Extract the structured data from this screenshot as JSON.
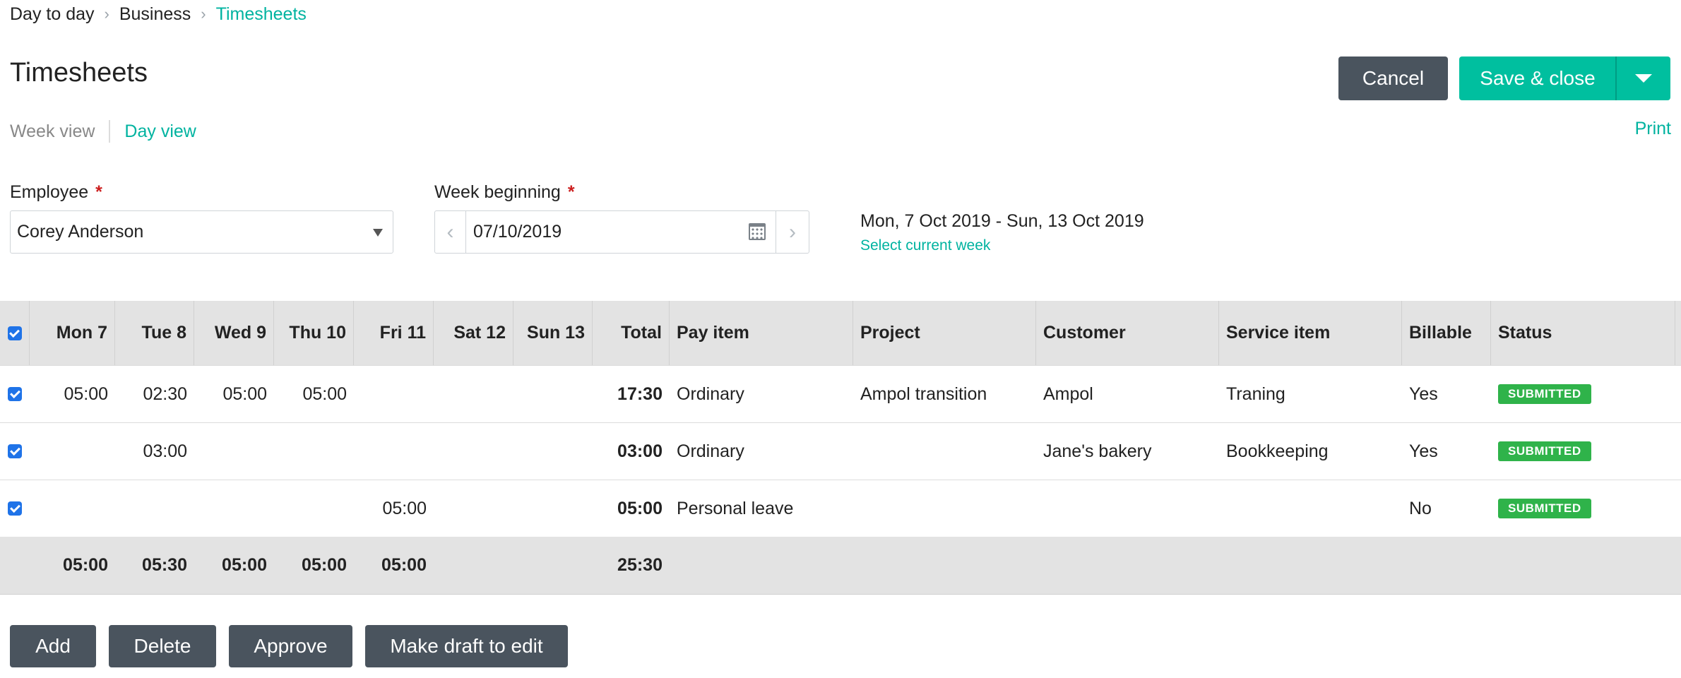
{
  "breadcrumb": [
    "Day to day",
    "Business",
    "Timesheets"
  ],
  "page_title": "Timesheets",
  "header_buttons": {
    "cancel": "Cancel",
    "save_close": "Save & close"
  },
  "view_tabs": {
    "week": "Week view",
    "day": "Day view",
    "print": "Print"
  },
  "form": {
    "employee_label": "Employee",
    "employee_value": "Corey  Anderson",
    "week_label": "Week beginning",
    "week_value": "07/10/2019",
    "required_mark": "*",
    "week_range": "Mon, 7 Oct 2019 - Sun, 13 Oct 2019",
    "select_current_week": "Select current week"
  },
  "table": {
    "columns": [
      "Mon 7",
      "Tue 8",
      "Wed 9",
      "Thu 10",
      "Fri 11",
      "Sat 12",
      "Sun 13",
      "Total",
      "Pay item",
      "Project",
      "Customer",
      "Service item",
      "Billable",
      "Status"
    ],
    "rows": [
      {
        "mon": "05:00",
        "tue": "02:30",
        "wed": "05:00",
        "thu": "05:00",
        "fri": "",
        "sat": "",
        "sun": "",
        "total": "17:30",
        "pay_item": "Ordinary",
        "project": "Ampol transition",
        "customer": "Ampol",
        "service_item": "Traning",
        "billable": "Yes",
        "status": "SUBMITTED"
      },
      {
        "mon": "",
        "tue": "03:00",
        "wed": "",
        "thu": "",
        "fri": "",
        "sat": "",
        "sun": "",
        "total": "03:00",
        "pay_item": "Ordinary",
        "project": "",
        "customer": "Jane's bakery",
        "service_item": "Bookkeeping",
        "billable": "Yes",
        "status": "SUBMITTED"
      },
      {
        "mon": "",
        "tue": "",
        "wed": "",
        "thu": "",
        "fri": "05:00",
        "sat": "",
        "sun": "",
        "total": "05:00",
        "pay_item": "Personal leave",
        "project": "",
        "customer": "",
        "service_item": "",
        "billable": "No",
        "status": "SUBMITTED"
      }
    ],
    "totals": {
      "mon": "05:00",
      "tue": "05:30",
      "wed": "05:00",
      "thu": "05:00",
      "fri": "05:00",
      "total": "25:30"
    }
  },
  "actions": {
    "add": "Add",
    "delete": "Delete",
    "approve": "Approve",
    "make_draft": "Make draft to edit"
  },
  "colors": {
    "accent": "#00b3a0",
    "primary_button": "#00bf9f",
    "dark_button": "#4a545e",
    "status_submitted": "#2fb34a",
    "required": "#cc1f1f"
  },
  "icons": {
    "breadcrumb_separator": "chevron-right-icon",
    "calendar": "calendar-icon",
    "dropdown": "caret-down-icon",
    "prev": "chevron-left-icon",
    "next": "chevron-right-icon"
  }
}
